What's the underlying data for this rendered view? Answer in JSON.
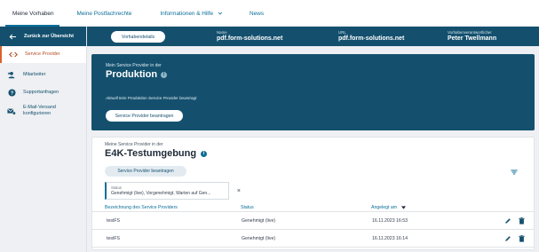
{
  "topnav": {
    "tabs": [
      {
        "label": "Meine Vorhaben",
        "active": true
      },
      {
        "label": "Meine Postfachrechte",
        "active": false
      },
      {
        "label": "Informationen & Hilfe",
        "active": false,
        "dropdown": true
      },
      {
        "label": "News",
        "active": false
      }
    ]
  },
  "sidebar": {
    "back_label": "Zurück zur Übersicht",
    "items": [
      {
        "label": "Service Provider",
        "icon": "code-arrows-icon",
        "active": true
      },
      {
        "label": "Mitarbeiter",
        "icon": "user-add-icon",
        "active": false
      },
      {
        "label": "Supportanfragen",
        "icon": "help-circle-icon",
        "active": false
      },
      {
        "label_line1": "E-Mail-Versand",
        "label_line2": "konfigurieren",
        "icon": "mail-settings-icon",
        "active": false
      }
    ]
  },
  "context": {
    "details_button": "Vorhabendetails",
    "name_label": "Name",
    "name_value": "pdf.form-solutions.net",
    "url_label": "URL",
    "url_value": "pdf.form-solutions.net",
    "owner_label": "Vorhabenverantwortlicher",
    "owner_value": "Peter Twellmann"
  },
  "production": {
    "subtitle": "Mein Service Provider in der",
    "title": "Produktion",
    "empty_text": "Aktuell kein Produktion Service Provider beantragt",
    "request_button": "Service Provider beantragen"
  },
  "e4k": {
    "subtitle": "Meine Service Provider in der",
    "title": "E4K-Testumgebung",
    "request_button": "Service Provider beantragen",
    "filter_chip": {
      "key": "Status",
      "value": "Genehmigt (live), Vorgenehmigt, Warten auf Gen..."
    },
    "columns": [
      "Bezeichnung des Service Providers",
      "Status",
      "Angelegt am"
    ],
    "rows": [
      {
        "name": "testFS",
        "status": "Genehmigt (live)",
        "created": "16.11.2023 16:53"
      },
      {
        "name": "testFS",
        "status": "Genehmigt (live)",
        "created": "16.11.2023 16:14"
      }
    ]
  },
  "colors": {
    "primary": "#14506e",
    "link": "#0b6e99",
    "accent": "#d9622b"
  }
}
